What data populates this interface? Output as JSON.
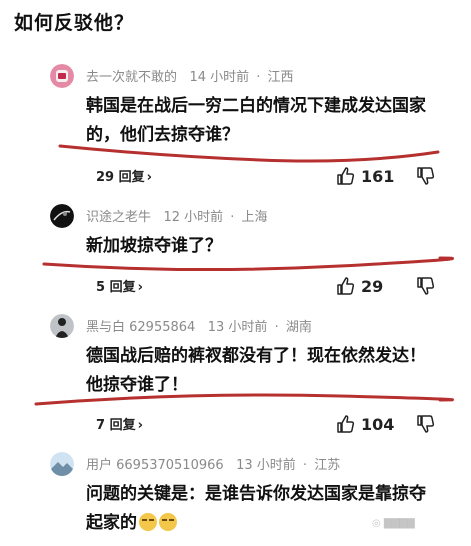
{
  "title": "如何反驳他？",
  "comments": [
    {
      "username": "去一次就不敢的",
      "time": "14 小时前",
      "location": "江西",
      "text": "韩国是在战后一穷二白的情况下建成发达国家的，他们去掠夺谁？",
      "replies": "29 回复",
      "likes": "161",
      "avatar_icon": "pink-cartoon-avatar-icon"
    },
    {
      "username": "识途之老牛",
      "time": "12 小时前",
      "location": "上海",
      "text": "新加坡掠夺谁了？",
      "replies": "5 回复",
      "likes": "29",
      "avatar_icon": "dark-planet-avatar-icon"
    },
    {
      "username": "黑与白 62955864",
      "time": "13 小时前",
      "location": "湖南",
      "text": "德国战后赔的裤衩都没有了！现在依然发达！他掠夺谁了！",
      "replies": "7 回复",
      "likes": "104",
      "avatar_icon": "person-silhouette-avatar-icon"
    },
    {
      "username": "用户 6695370510966",
      "time": "13 小时前",
      "location": "江苏",
      "text": "问题的关键是：是谁告诉你发达国家是靠掠夺起家的",
      "avatar_icon": "landscape-avatar-icon"
    }
  ],
  "colors": {
    "underline": "#b5302e",
    "meta": "#8a8a8a"
  }
}
